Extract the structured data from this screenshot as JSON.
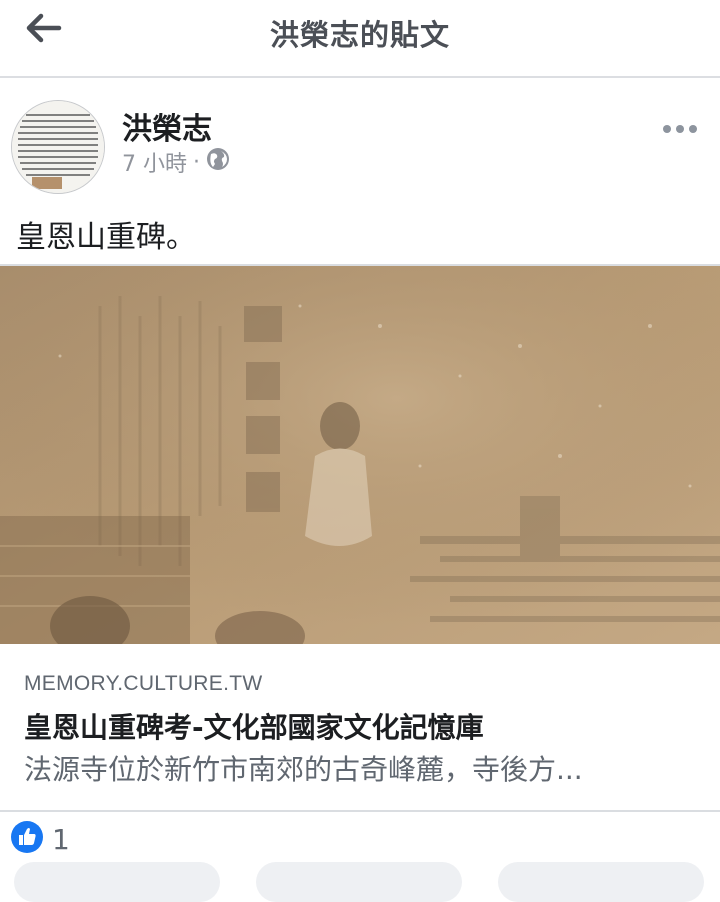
{
  "header": {
    "title": "洪榮志的貼文",
    "back_icon": "arrow-left-icon"
  },
  "post": {
    "author": "洪榮志",
    "time": "7 小時",
    "separator": "·",
    "audience_icon": "globe-icon",
    "text": "皇恩山重碑。"
  },
  "link_preview": {
    "domain": "MEMORY.CULTURE.TW",
    "title": "皇恩山重碑考-文化部國家文化記憶庫",
    "description": "法源寺位於新竹市南郊的古奇峰麓，寺後方..."
  },
  "reactions": {
    "icon": "like-icon",
    "count": "1",
    "color": "#1877f2"
  },
  "colors": {
    "text": "#1c1e21",
    "muted": "#90949c",
    "divider": "#dadde1",
    "sepia": "#b89a72"
  }
}
